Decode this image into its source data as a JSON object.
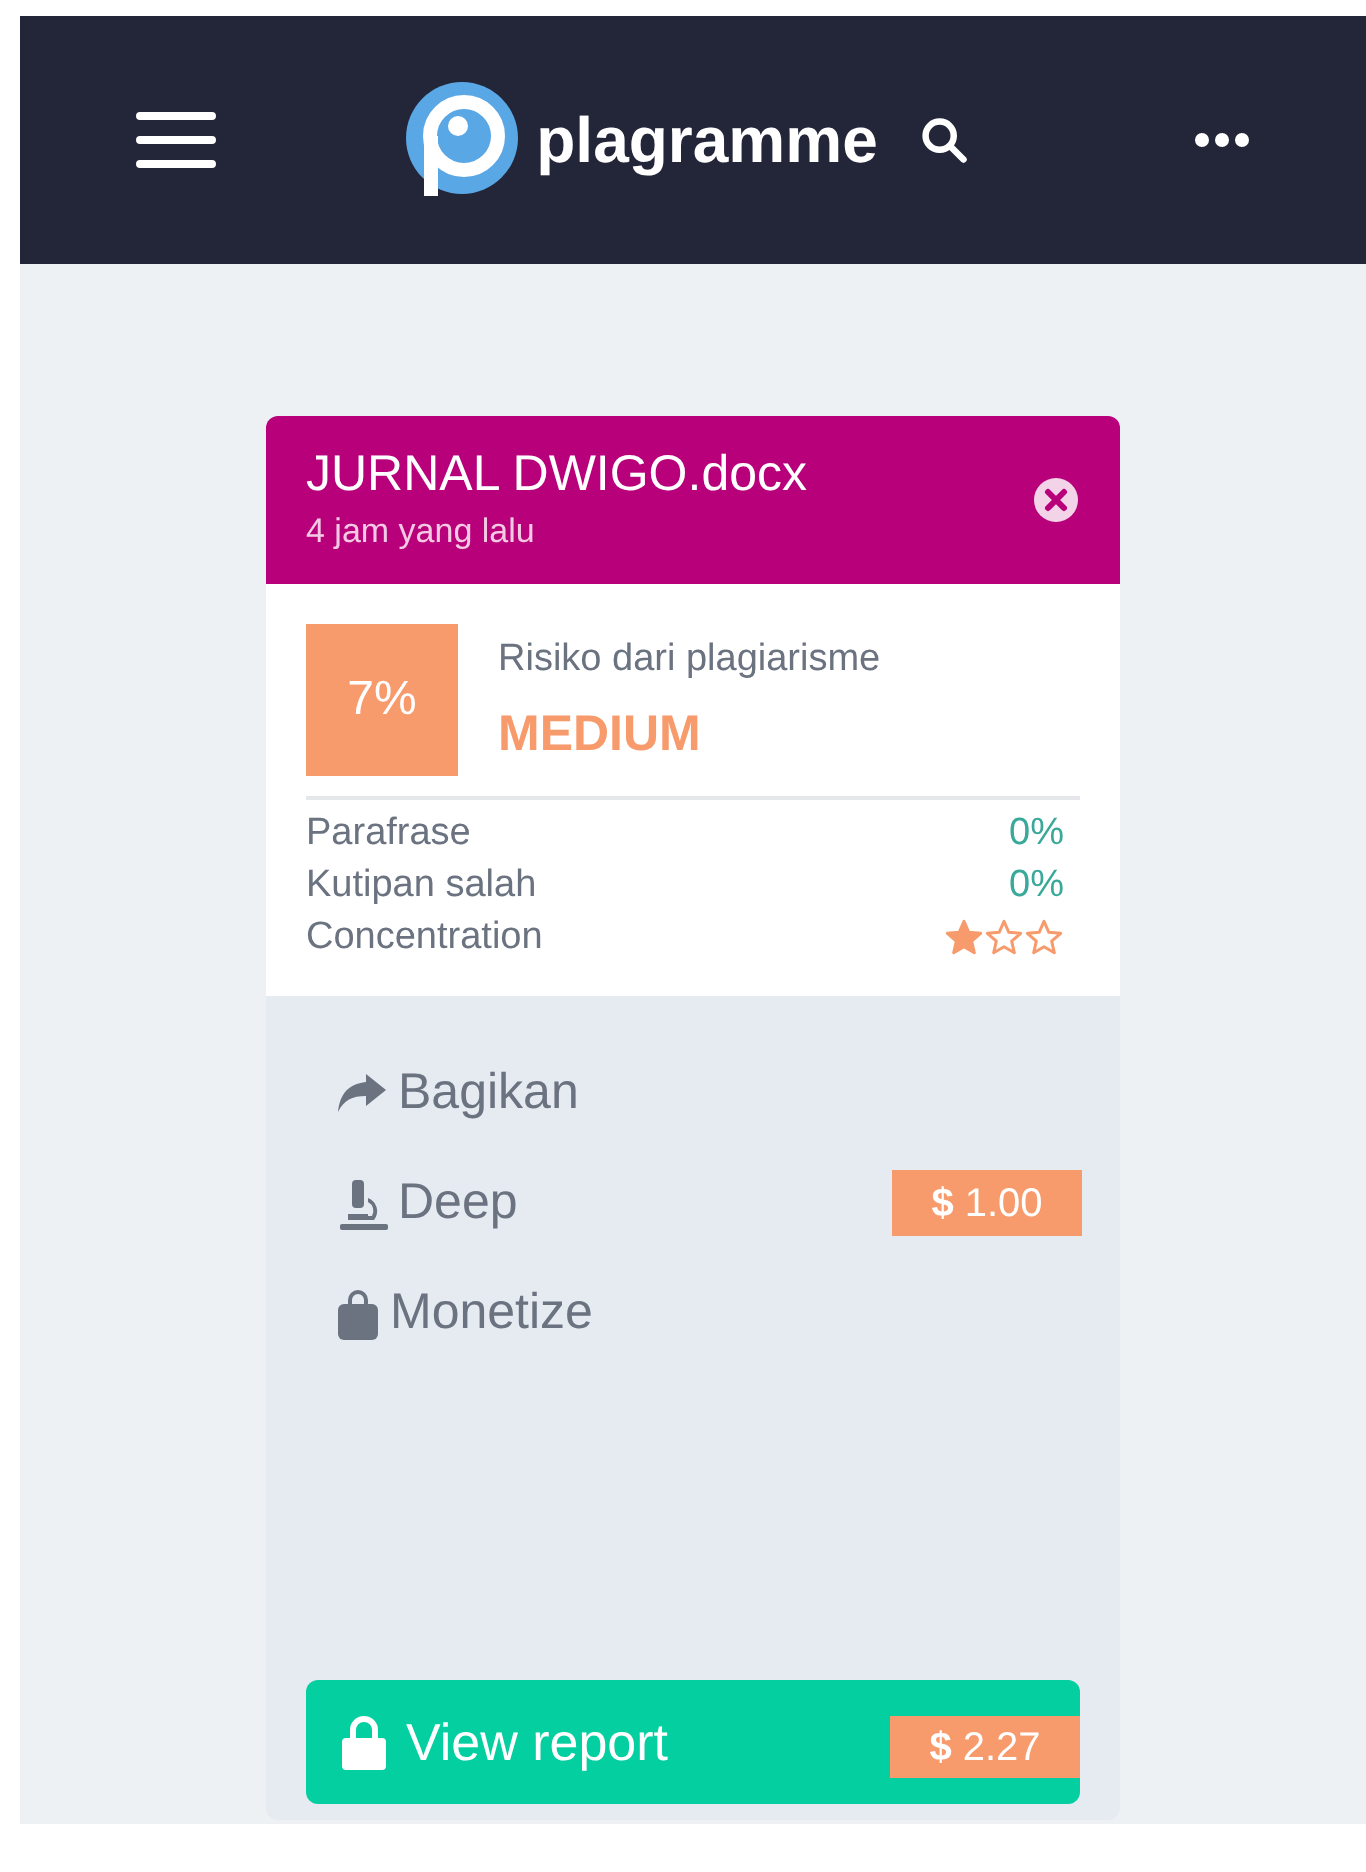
{
  "app_bar": {
    "brand": "plagramme"
  },
  "card": {
    "file_name": "JURNAL DWIGO.docx",
    "time": "4 jam yang lalu",
    "score": "7%",
    "risk_label": "Risiko dari plagiarisme",
    "risk_level": "MEDIUM",
    "metrics": [
      {
        "kind": "percent",
        "label": "Parafrase",
        "value": "0%"
      },
      {
        "kind": "percent",
        "label": "Kutipan salah",
        "value": "0%"
      },
      {
        "kind": "stars",
        "label": "Concentration",
        "stars": 1
      }
    ],
    "actions": [
      {
        "kind": "share",
        "label": "Bagikan"
      },
      {
        "kind": "deep",
        "label": "Deep",
        "price": "**$** 1.00"
      },
      {
        "kind": "monetize",
        "label": "Monetize"
      }
    ],
    "report_button": {
      "label": "View report",
      "price": "**$** 2.27"
    }
  }
}
